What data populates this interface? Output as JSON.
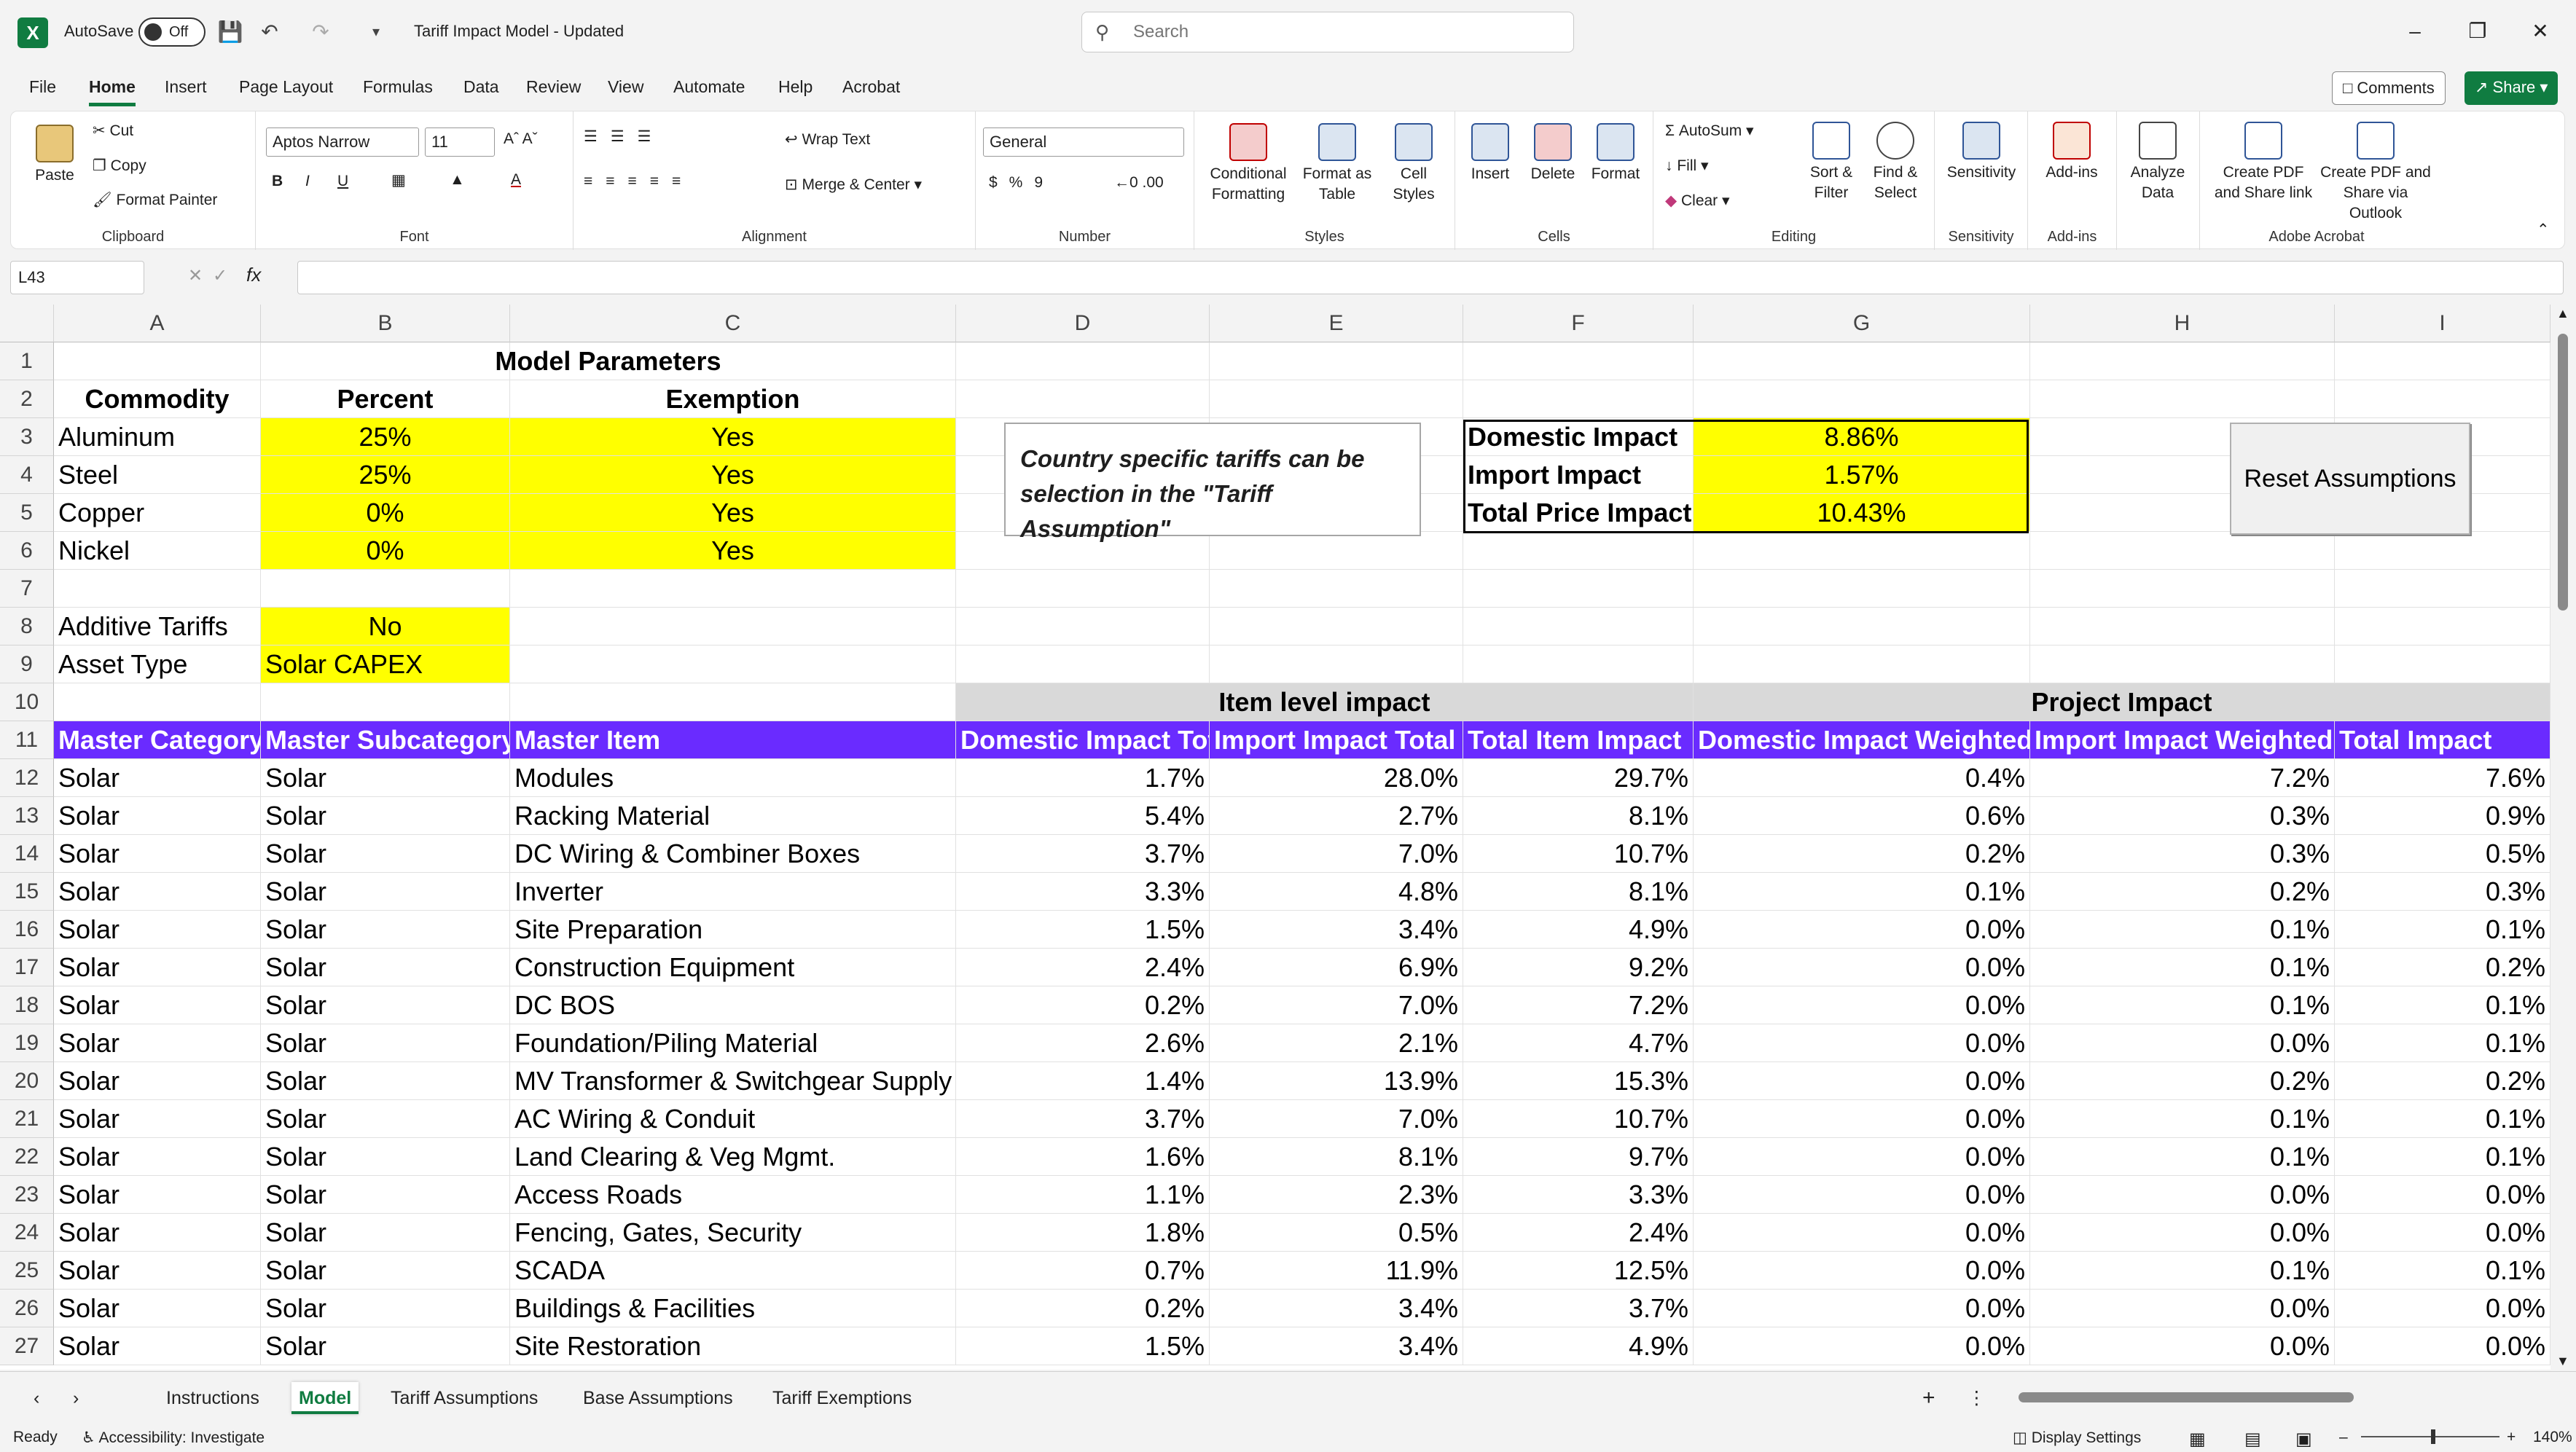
{
  "titlebar": {
    "autosave_label": "AutoSave",
    "autosave_state": "Off",
    "doc_title": "Tariff Impact Model - Updated",
    "search_placeholder": "Search"
  },
  "menu": {
    "tabs": [
      "File",
      "Home",
      "Insert",
      "Page Layout",
      "Formulas",
      "Data",
      "Review",
      "View",
      "Automate",
      "Help",
      "Acrobat"
    ],
    "comments": "Comments",
    "share": "Share"
  },
  "ribbon": {
    "clipboard": {
      "paste": "Paste",
      "cut": "Cut",
      "copy": "Copy",
      "format_painter": "Format Painter",
      "label": "Clipboard"
    },
    "font": {
      "name": "Aptos Narrow",
      "size": "11",
      "label": "Font"
    },
    "alignment": {
      "wrap": "Wrap Text",
      "merge": "Merge & Center",
      "label": "Alignment"
    },
    "number": {
      "format": "General",
      "label": "Number"
    },
    "styles": {
      "cond": "Conditional Formatting",
      "table": "Format as Table",
      "cell": "Cell Styles",
      "label": "Styles"
    },
    "cells": {
      "insert": "Insert",
      "delete": "Delete",
      "format": "Format",
      "label": "Cells"
    },
    "editing": {
      "autosum": "AutoSum",
      "fill": "Fill",
      "clear": "Clear",
      "sort": "Sort & Filter",
      "find": "Find & Select",
      "label": "Editing"
    },
    "sensitivity": {
      "btn": "Sensitivity",
      "label": "Sensitivity"
    },
    "addins": {
      "btn": "Add-ins",
      "label": "Add-ins"
    },
    "analyze": {
      "btn": "Analyze Data"
    },
    "acrobat": {
      "pdf_link": "Create PDF and Share link",
      "pdf_outlook": "Create PDF and Share via Outlook",
      "label": "Adobe Acrobat"
    }
  },
  "formula_bar": {
    "name_box": "L43",
    "fx": "fx",
    "content": ""
  },
  "columns": [
    "A",
    "B",
    "C",
    "D",
    "E",
    "F",
    "G",
    "H",
    "I"
  ],
  "rows": [
    "1",
    "2",
    "3",
    "4",
    "5",
    "6",
    "7",
    "8",
    "9",
    "10",
    "11",
    "12",
    "13",
    "14",
    "15",
    "16",
    "17",
    "18",
    "19",
    "20",
    "21",
    "22",
    "23",
    "24",
    "25",
    "26",
    "27"
  ],
  "params": {
    "title": "Model Parameters",
    "headers": [
      "Commodity",
      "Percent",
      "Exemption"
    ],
    "items": [
      {
        "commodity": "Aluminum",
        "percent": "25%",
        "exempt": "Yes"
      },
      {
        "commodity": "Steel",
        "percent": "25%",
        "exempt": "Yes"
      },
      {
        "commodity": "Copper",
        "percent": "0%",
        "exempt": "Yes"
      },
      {
        "commodity": "Nickel",
        "percent": "0%",
        "exempt": "Yes"
      }
    ],
    "additive_label": "Additive Tariffs",
    "additive_value": "No",
    "asset_label": "Asset Type",
    "asset_value": "Solar CAPEX"
  },
  "note": "Country specific tariffs can be selection in the \"Tariff Assumption\"",
  "impact": [
    {
      "label": "Domestic Impact",
      "value": "8.86%"
    },
    {
      "label": "Import Impact",
      "value": "1.57%"
    },
    {
      "label": "Total Price Impact",
      "value": "10.43%"
    }
  ],
  "reset_button": "Reset Assumptions",
  "section_item": "Item level impact",
  "section_project": "Project Impact",
  "table_headers": [
    "Master Category",
    "Master Subcategory",
    "Master Item",
    "Domestic Impact Total",
    "Import Impact Total",
    "Total Item Impact",
    "Domestic Impact Weighted",
    "Import Impact Weighted",
    "Total Impact"
  ],
  "table_rows": [
    [
      "Solar",
      "Solar",
      "Modules",
      "1.7%",
      "28.0%",
      "29.7%",
      "0.4%",
      "7.2%",
      "7.6%"
    ],
    [
      "Solar",
      "Solar",
      "Racking Material",
      "5.4%",
      "2.7%",
      "8.1%",
      "0.6%",
      "0.3%",
      "0.9%"
    ],
    [
      "Solar",
      "Solar",
      "DC Wiring & Combiner Boxes",
      "3.7%",
      "7.0%",
      "10.7%",
      "0.2%",
      "0.3%",
      "0.5%"
    ],
    [
      "Solar",
      "Solar",
      "Inverter",
      "3.3%",
      "4.8%",
      "8.1%",
      "0.1%",
      "0.2%",
      "0.3%"
    ],
    [
      "Solar",
      "Solar",
      "Site Preparation",
      "1.5%",
      "3.4%",
      "4.9%",
      "0.0%",
      "0.1%",
      "0.1%"
    ],
    [
      "Solar",
      "Solar",
      "Construction Equipment",
      "2.4%",
      "6.9%",
      "9.2%",
      "0.0%",
      "0.1%",
      "0.2%"
    ],
    [
      "Solar",
      "Solar",
      "DC BOS",
      "0.2%",
      "7.0%",
      "7.2%",
      "0.0%",
      "0.1%",
      "0.1%"
    ],
    [
      "Solar",
      "Solar",
      "Foundation/Piling Material",
      "2.6%",
      "2.1%",
      "4.7%",
      "0.0%",
      "0.0%",
      "0.1%"
    ],
    [
      "Solar",
      "Solar",
      "MV Transformer & Switchgear Supply",
      "1.4%",
      "13.9%",
      "15.3%",
      "0.0%",
      "0.2%",
      "0.2%"
    ],
    [
      "Solar",
      "Solar",
      "AC Wiring & Conduit",
      "3.7%",
      "7.0%",
      "10.7%",
      "0.0%",
      "0.1%",
      "0.1%"
    ],
    [
      "Solar",
      "Solar",
      "Land Clearing & Veg Mgmt.",
      "1.6%",
      "8.1%",
      "9.7%",
      "0.0%",
      "0.1%",
      "0.1%"
    ],
    [
      "Solar",
      "Solar",
      "Access Roads",
      "1.1%",
      "2.3%",
      "3.3%",
      "0.0%",
      "0.0%",
      "0.0%"
    ],
    [
      "Solar",
      "Solar",
      "Fencing, Gates, Security",
      "1.8%",
      "0.5%",
      "2.4%",
      "0.0%",
      "0.0%",
      "0.0%"
    ],
    [
      "Solar",
      "Solar",
      "SCADA",
      "0.7%",
      "11.9%",
      "12.5%",
      "0.0%",
      "0.1%",
      "0.1%"
    ],
    [
      "Solar",
      "Solar",
      "Buildings & Facilities",
      "0.2%",
      "3.4%",
      "3.7%",
      "0.0%",
      "0.0%",
      "0.0%"
    ],
    [
      "Solar",
      "Solar",
      "Site Restoration",
      "1.5%",
      "3.4%",
      "4.9%",
      "0.0%",
      "0.0%",
      "0.0%"
    ]
  ],
  "sheets": [
    "Instructions",
    "Model",
    "Tariff Assumptions",
    "Base Assumptions",
    "Tariff Exemptions"
  ],
  "active_sheet": "Model",
  "status": {
    "ready": "Ready",
    "accessibility": "Accessibility: Investigate",
    "display": "Display Settings",
    "zoom": "140%"
  }
}
